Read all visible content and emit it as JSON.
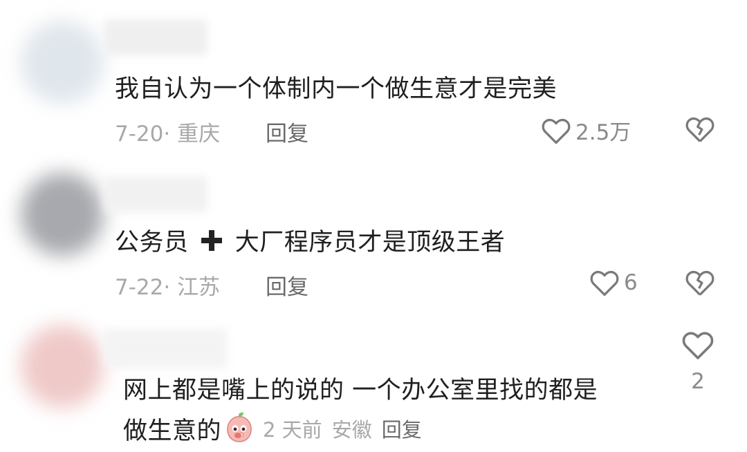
{
  "comments": [
    {
      "text": "我自认为一个体制内一个做生意才是完美",
      "date_location": "7-20· 重庆",
      "reply": "回复",
      "likes": "2.5万"
    },
    {
      "text_before": "公务员",
      "text_after": "大厂程序员才是顶级王者",
      "date_location": "7-22· 江苏",
      "reply": "回复",
      "likes": "6"
    },
    {
      "line1": "网上都是嘴上的说的 一个办公室里找的都是",
      "line2": "做生意的",
      "time": "2 天前",
      "location": "安徽",
      "reply": "回复",
      "likes": "2"
    }
  ],
  "icons": {
    "like": "heart-outline-icon",
    "dislike": "broken-heart-icon",
    "plus": "plus-icon",
    "emoji": "peach-emoji-icon"
  },
  "colors": {
    "primary_text": "#1f1f1f",
    "meta_text": "#a8a8a8",
    "reply_text": "#6a6a6a",
    "icon": "#7a7a7a"
  }
}
